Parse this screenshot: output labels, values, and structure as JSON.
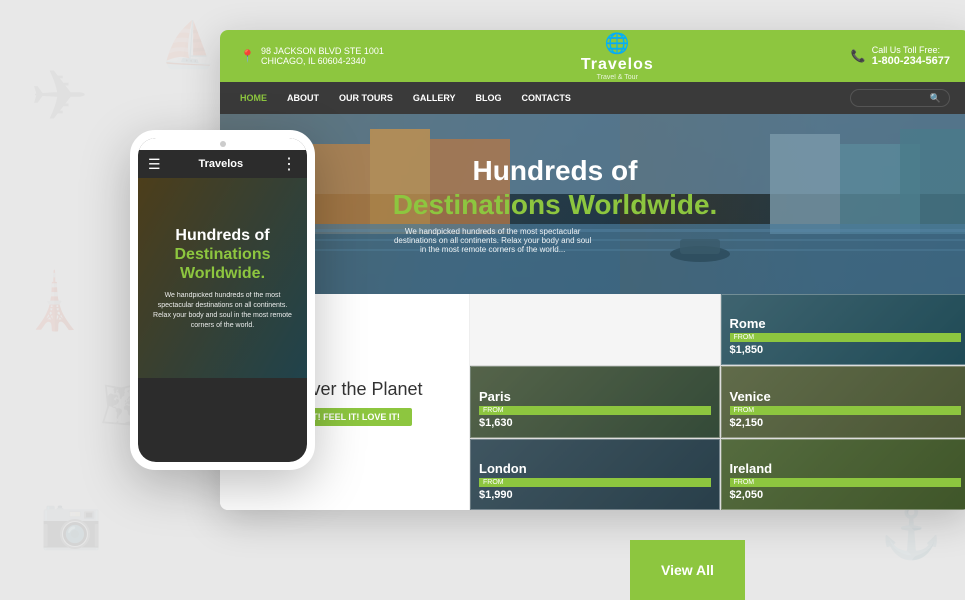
{
  "page": {
    "background_color": "#e8e8e8"
  },
  "desktop": {
    "header": {
      "address_line1": "98 JACKSON BLVD STE 1001",
      "address_line2": "CHICAGO, IL 60604-2340",
      "logo_name": "Travelos",
      "logo_sub": "Travel & Tour",
      "phone_label": "Call Us Toll Free:",
      "phone_number": "1-800-234-5677"
    },
    "nav": {
      "items": [
        {
          "label": "HOME",
          "active": true
        },
        {
          "label": "ABOUT",
          "active": false
        },
        {
          "label": "OUR TOURS",
          "active": false
        },
        {
          "label": "GALLERY",
          "active": false
        },
        {
          "label": "BLOG",
          "active": false
        },
        {
          "label": "CONTACTS",
          "active": false
        }
      ],
      "search_placeholder": "Search"
    },
    "hero": {
      "title_line1": "Hundreds of",
      "title_line2": "Destinations Worldwide.",
      "subtitle": "We handpicked hundreds of the most spectacular destinations on all continents. Relax your body and soul in the most remote corners of the world..."
    },
    "discover": {
      "title": "Discover the Planet",
      "button_label": "SEE IT! FEEL IT! LOVE IT!"
    },
    "destinations": [
      {
        "name": "Rome",
        "from_label": "FROM",
        "price": "$1,850",
        "color": "#5a8fa0",
        "position": "top-right"
      },
      {
        "name": "Paris",
        "from_label": "FROM",
        "price": "$1,630",
        "color": "#7a8f6a"
      },
      {
        "name": "Venice",
        "from_label": "FROM",
        "price": "$2,150",
        "color": "#8a7a5a"
      },
      {
        "name": "London",
        "from_label": "FROM",
        "price": "$1,990",
        "color": "#5a7a8a"
      },
      {
        "name": "Ireland",
        "from_label": "FROM",
        "price": "$2,050",
        "color": "#7a9a5a"
      },
      {
        "name": "View All",
        "is_viewall": true,
        "color": "#8dc63f"
      }
    ]
  },
  "mobile": {
    "logo": "Travelos",
    "hero": {
      "title_line1": "Hundreds of",
      "title_line2": "Destinations",
      "title_line3": "Worldwide.",
      "body": "We handpicked hundreds of the most spectacular destinations on all continents. Relax your body and soul in the most remote corners of the world."
    }
  }
}
